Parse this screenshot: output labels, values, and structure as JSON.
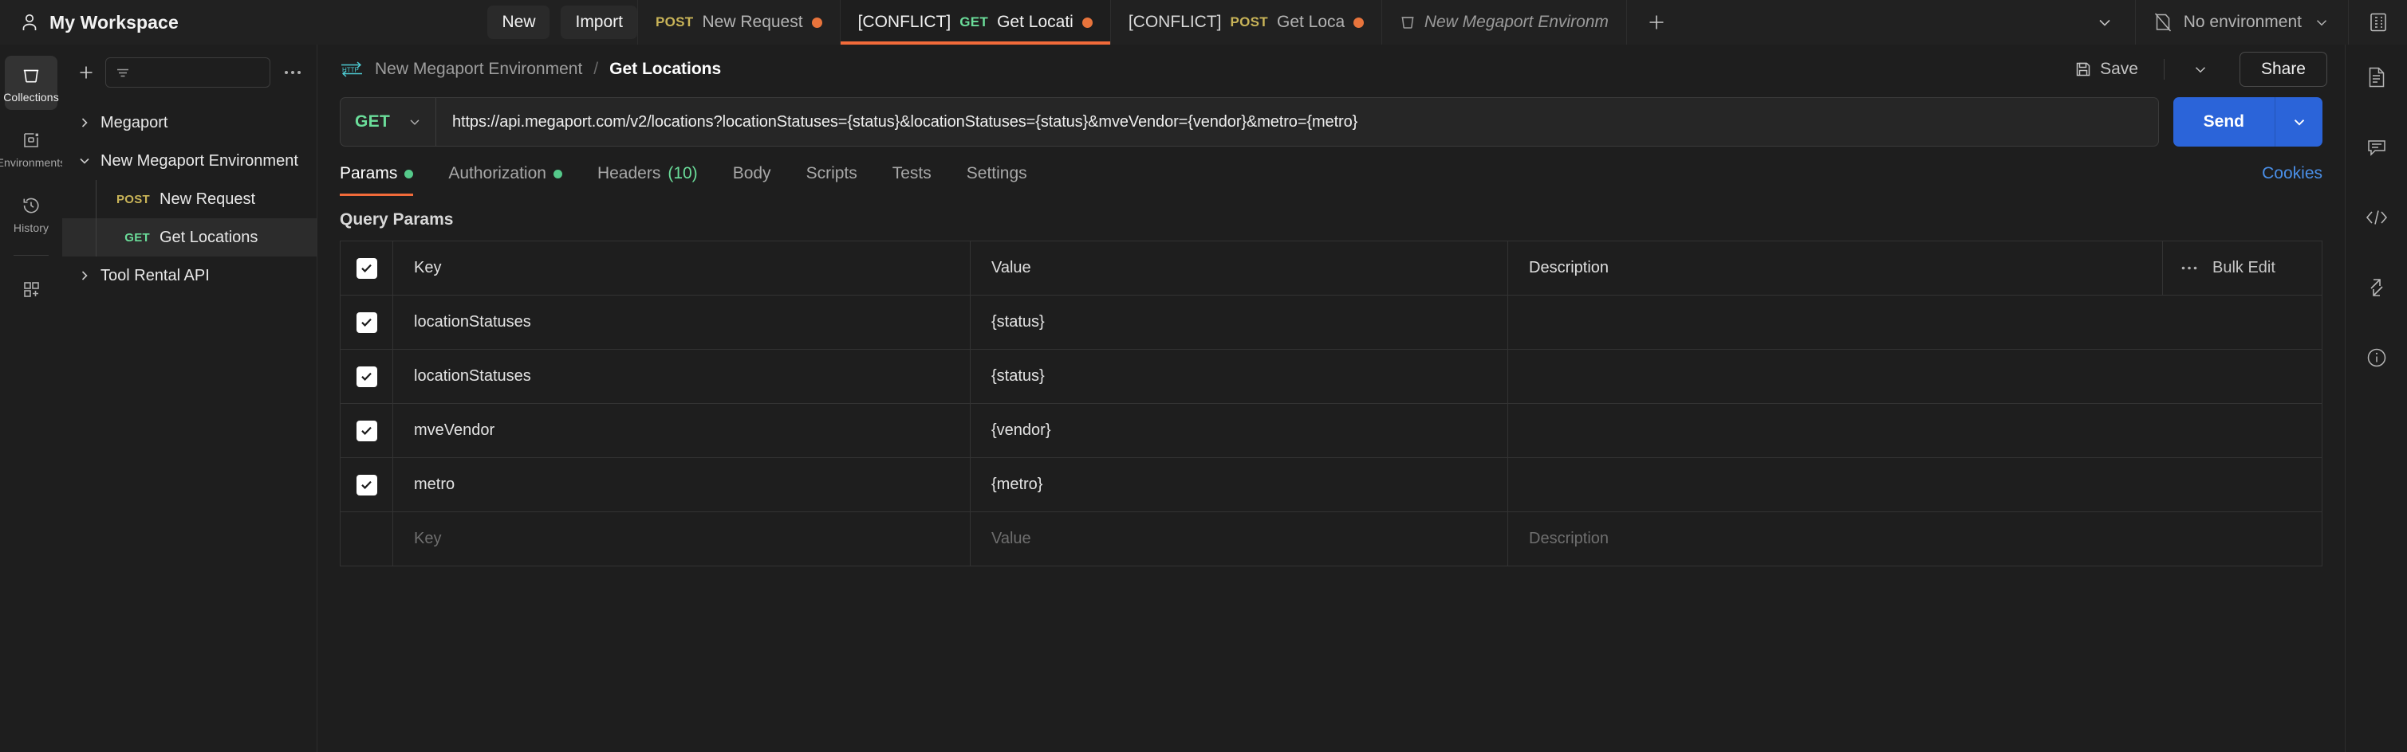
{
  "topbar": {
    "workspace_name": "My Workspace",
    "workspace_icon": "user-icon",
    "new_label": "New",
    "import_label": "Import",
    "add_tab_icon": "plus-icon",
    "tabs_overflow_icon": "chevron-down-icon",
    "environment_selector": {
      "icon": "no-environment-icon",
      "label": "No environment",
      "chevron": "chevron-down-icon"
    },
    "right_icon": "layout-grid-icon",
    "tabs": [
      {
        "conflict": "",
        "method": "POST",
        "title": "New Request",
        "unsaved": true,
        "active": false,
        "env": false
      },
      {
        "conflict": "[CONFLICT]",
        "method": "GET",
        "title": "Get Locati",
        "unsaved": true,
        "active": true,
        "env": false
      },
      {
        "conflict": "[CONFLICT]",
        "method": "POST",
        "title": "Get Locat",
        "unsaved": true,
        "active": false,
        "env": false
      },
      {
        "conflict": "",
        "method": "",
        "title": "New Megaport Environm",
        "unsaved": false,
        "active": false,
        "env": true
      }
    ]
  },
  "rail": {
    "items": [
      {
        "label": "Collections",
        "icon": "collections-icon",
        "active": true
      },
      {
        "label": "Environments",
        "icon": "environments-icon",
        "active": false
      },
      {
        "label": "History",
        "icon": "history-icon",
        "active": false
      }
    ],
    "add_icon": "new-grid-plus-icon"
  },
  "sidebar": {
    "new_icon": "plus-icon",
    "search_placeholder": "",
    "filter_icon": "filter-icon",
    "more_icon": "more-horizontal-icon",
    "tree": [
      {
        "type": "collection",
        "name": "Megaport",
        "expanded": false,
        "selected": false
      },
      {
        "type": "collection",
        "name": "New Megaport Environment",
        "expanded": true,
        "selected": false
      },
      {
        "type": "request",
        "method": "POST",
        "name": "New Request",
        "selected": false
      },
      {
        "type": "request",
        "method": "GET",
        "name": "Get Locations",
        "selected": true
      },
      {
        "type": "collection",
        "name": "Tool Rental API",
        "expanded": false,
        "selected": false
      }
    ]
  },
  "main": {
    "breadcrumb": {
      "protocol_icon": "http-icon",
      "parent": "New Megaport Environment",
      "separator": "/",
      "current": "Get Locations"
    },
    "save_label": "Save",
    "save_icon": "save-icon",
    "save_chevron": "chevron-down-icon",
    "share_label": "Share",
    "request": {
      "method": "GET",
      "method_chevron": "chevron-down-icon",
      "url": "https://api.megaport.com/v2/locations?locationStatuses={status}&locationStatuses={status}&mveVendor={vendor}&metro={metro}",
      "send_label": "Send",
      "send_chevron": "chevron-down-icon"
    },
    "tabs": [
      {
        "label": "Params",
        "dot": true,
        "count": "",
        "active": true
      },
      {
        "label": "Authorization",
        "dot": true,
        "count": "",
        "active": false
      },
      {
        "label": "Headers",
        "dot": false,
        "count": "(10)",
        "active": false
      },
      {
        "label": "Body",
        "dot": false,
        "count": "",
        "active": false
      },
      {
        "label": "Scripts",
        "dot": false,
        "count": "",
        "active": false
      },
      {
        "label": "Tests",
        "dot": false,
        "count": "",
        "active": false
      },
      {
        "label": "Settings",
        "dot": false,
        "count": "",
        "active": false
      }
    ],
    "cookies_label": "Cookies",
    "query_params_title": "Query Params",
    "table": {
      "headers": {
        "key": "Key",
        "value": "Value",
        "description": "Description"
      },
      "bulk_edit_label": "Bulk Edit",
      "bulk_more_icon": "more-horizontal-icon",
      "rows": [
        {
          "checked": true,
          "key": "locationStatuses",
          "value": "{status}",
          "description": ""
        },
        {
          "checked": true,
          "key": "locationStatuses",
          "value": "{status}",
          "description": ""
        },
        {
          "checked": true,
          "key": "mveVendor",
          "value": "{vendor}",
          "description": ""
        },
        {
          "checked": true,
          "key": "metro",
          "value": "{metro}",
          "description": ""
        }
      ],
      "empty_row": {
        "key": "Key",
        "value": "Value",
        "description": "Description"
      }
    }
  },
  "right_rail": {
    "icons": [
      "documentation-icon",
      "comment-icon",
      "code-icon",
      "expand-arrows-icon",
      "info-icon"
    ]
  },
  "colors": {
    "accent_orange": "#f26b3a",
    "send_blue": "#2b64d9",
    "get_green": "#6bdd9a",
    "post_yellow": "#c9b458",
    "link_blue": "#4a8fe8",
    "background": "#1e1e1e",
    "topbar": "#212121"
  }
}
